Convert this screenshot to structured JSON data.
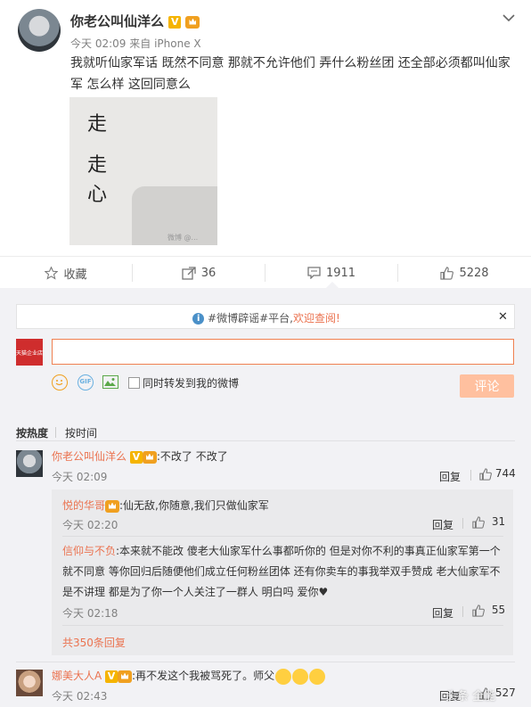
{
  "post": {
    "author": "你老公叫仙洋么",
    "time": "今天 02:09",
    "source_prefix": "来自",
    "source": "iPhone X",
    "text": "我就听仙家军话 既然不同意 那就不允许他们 弄什么粉丝团 还全部必须都叫仙家军 怎么样 这回同意么",
    "image_chars": [
      "走",
      "走",
      "心"
    ],
    "image_small_text": "微博 @...",
    "v_badge": "V"
  },
  "actions": {
    "favorite_label": "收藏",
    "repost_count": "36",
    "comment_count": "1911",
    "like_count": "5228"
  },
  "notice": {
    "text_prefix": "#微博辟谣#平台,",
    "text_link": "欢迎查阅!"
  },
  "composer": {
    "input_value": "",
    "repost_checkbox_label": "同时转发到我的微博",
    "submit_label": "评论",
    "user_avatar_text": "天猫企业店"
  },
  "sort": {
    "hot_label": "按热度",
    "time_label": "按时间"
  },
  "comments": [
    {
      "author": "你老公叫仙洋么",
      "text": ":不改了 不改了",
      "time": "今天 02:09",
      "reply_label": "回复",
      "likes": "744",
      "replies": [
        {
          "author": "悦的华哥",
          "text": ":仙无敌,你随意,我们只做仙家军",
          "time": "今天 02:20",
          "reply_label": "回复",
          "likes": "31"
        },
        {
          "author": "信仰与不负",
          "text": ":本来就不能改 傻老大仙家军什么事都听你的 但是对你不利的事真正仙家军第一个就不同意 等你回归后随便他们成立任何粉丝团体 还有你卖车的事我举双手赞成 老大仙家军不是不讲理 都是为了你一个人关注了一群人 明白吗 爱你",
          "time": "今天 02:18",
          "reply_label": "回复",
          "likes": "55"
        }
      ],
      "more_replies": "共350条回复"
    },
    {
      "author": "娜美大人A",
      "text": ":再不发这个我被骂死了。师父",
      "time": "今天 02:43",
      "reply_label": "回复",
      "likes": "527"
    }
  ],
  "watermark": "头条 全能",
  "colors": {
    "accent": "#eb7350",
    "button": "#ffc09f",
    "badge": "#f5b400",
    "reply_bg": "#f2f2f5"
  }
}
